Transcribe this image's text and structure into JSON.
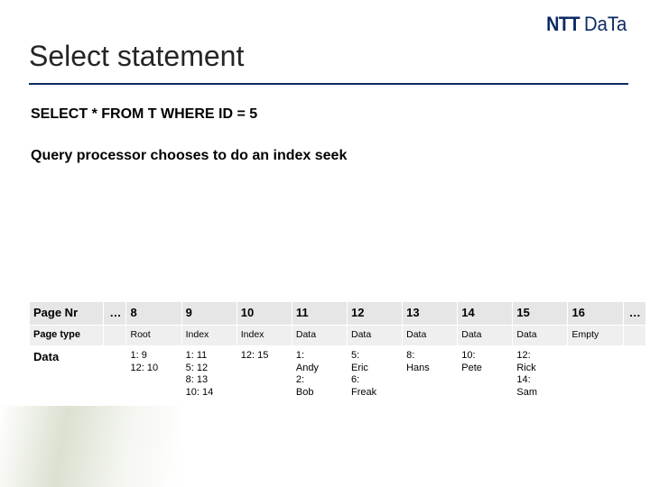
{
  "logo": {
    "ntt": "NTT",
    "data": "DaTa"
  },
  "title": "Select statement",
  "sql_line": "SELECT * FROM T WHERE ID = 5",
  "qp_line": "Query processor chooses to do an index seek",
  "table": {
    "row_labels": {
      "page_nr": "Page Nr",
      "page_type": "Page type",
      "data": "Data"
    },
    "ellipsis": "…",
    "columns": [
      {
        "nr": "8",
        "type": "Root",
        "data": [
          "1: 9",
          "12: 10"
        ]
      },
      {
        "nr": "9",
        "type": "Index",
        "data": [
          "1: 11",
          "5: 12",
          "8: 13",
          "10: 14"
        ]
      },
      {
        "nr": "10",
        "type": "Index",
        "data": [
          "12: 15"
        ]
      },
      {
        "nr": "11",
        "type": "Data",
        "data": [
          "1:",
          "Andy",
          "2:",
          "Bob"
        ]
      },
      {
        "nr": "12",
        "type": "Data",
        "data": [
          "5:",
          "Eric",
          "6:",
          "Freak"
        ]
      },
      {
        "nr": "13",
        "type": "Data",
        "data": [
          "8:",
          "Hans"
        ]
      },
      {
        "nr": "14",
        "type": "Data",
        "data": [
          "10:",
          "Pete"
        ]
      },
      {
        "nr": "15",
        "type": "Data",
        "data": [
          "12:",
          "Rick",
          "14:",
          "Sam"
        ]
      },
      {
        "nr": "16",
        "type": "Empty",
        "data": []
      }
    ]
  }
}
